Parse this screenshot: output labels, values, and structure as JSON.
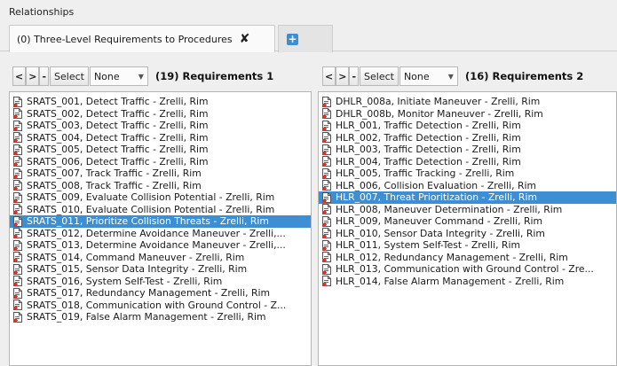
{
  "panel": {
    "title": "Relationships"
  },
  "tabs": [
    {
      "label": "(0) Three-Level Requirements to Procedures"
    }
  ],
  "colors": {
    "selection": "#3d8ed3",
    "add_tab": "#3b8fd1"
  },
  "left": {
    "nav_prev": "<",
    "nav_next": ">",
    "nav_minus": "-",
    "select_label": "Select",
    "filter_value": "None",
    "count_label": "(19) Requirements 1",
    "items": [
      "SRATS_001, Detect Traffic - Zrelli, Rim",
      "SRATS_002, Detect Traffic - Zrelli, Rim",
      "SRATS_003, Detect Traffic - Zrelli, Rim",
      "SRATS_004, Detect Traffic - Zrelli, Rim",
      "SRATS_005, Detect Traffic - Zrelli, Rim",
      "SRATS_006, Detect Traffic - Zrelli, Rim",
      "SRATS_007, Track Traffic - Zrelli, Rim",
      "SRATS_008, Track Traffic - Zrelli, Rim",
      "SRATS_009, Evaluate Collision Potential - Zrelli, Rim",
      "SRATS_010, Evaluate Collision Potential - Zrelli, Rim",
      "SRATS_011, Prioritize Collision Threats - Zrelli, Rim",
      "SRATS_012, Determine Avoidance Maneuver - Zrelli,...",
      "SRATS_013, Determine Avoidance Maneuver - Zrelli,...",
      "SRATS_014, Command Maneuver - Zrelli, Rim",
      "SRATS_015, Sensor Data Integrity - Zrelli, Rim",
      "SRATS_016, System Self-Test - Zrelli, Rim",
      "SRATS_017, Redundancy Management - Zrelli, Rim",
      "SRATS_018, Communication with Ground Control - Z...",
      "SRATS_019, False Alarm Management - Zrelli, Rim"
    ],
    "selected_index": 10
  },
  "right": {
    "nav_prev": "<",
    "nav_next": ">",
    "nav_minus": "-",
    "select_label": "Select",
    "filter_value": "None",
    "count_label": "(16) Requirements 2",
    "items": [
      "DHLR_008a, Initiate Maneuver - Zrelli, Rim",
      "DHLR_008b, Monitor Maneuver - Zrelli, Rim",
      "HLR_001, Traffic Detection - Zrelli, Rim",
      "HLR_002, Traffic Detection - Zrelli, Rim",
      "HLR_003, Traffic Detection - Zrelli, Rim",
      "HLR_004, Traffic Detection - Zrelli, Rim",
      "HLR_005, Traffic Tracking - Zrelli, Rim",
      "HLR_006, Collision Evaluation - Zrelli, Rim",
      "HLR_007, Threat Prioritization - Zrelli, Rim",
      "HLR_008, Maneuver Determination - Zrelli, Rim",
      "HLR_009, Maneuver Command - Zrelli, Rim",
      "HLR_010, Sensor Data Integrity - Zrelli, Rim",
      "HLR_011, System Self-Test - Zrelli, Rim",
      "HLR_012, Redundancy Management - Zrelli, Rim",
      "HLR_013, Communication with Ground Control - Zre...",
      "HLR_014, False Alarm Management - Zrelli, Rim"
    ],
    "selected_index": 8
  }
}
